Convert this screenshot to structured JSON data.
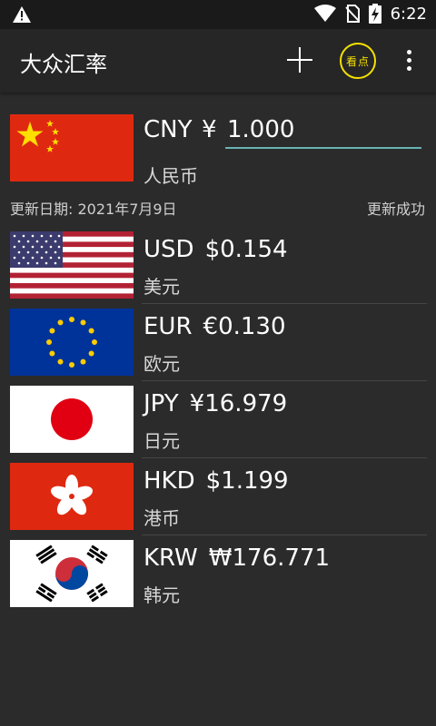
{
  "status_bar": {
    "time": "6:22"
  },
  "app_bar": {
    "title": "大众汇率",
    "kandian_label": "看点"
  },
  "base": {
    "code": "CNY",
    "symbol": "¥",
    "amount": "1.000",
    "name": "人民币"
  },
  "update_date": "更新日期: 2021年7月9日",
  "update_status": "更新成功",
  "currencies": [
    {
      "code": "USD",
      "value": "$0.154",
      "name": "美元"
    },
    {
      "code": "EUR",
      "value": "€0.130",
      "name": "欧元"
    },
    {
      "code": "JPY",
      "value": "¥16.979",
      "name": "日元"
    },
    {
      "code": "HKD",
      "value": "$1.199",
      "name": "港币"
    },
    {
      "code": "KRW",
      "value": "₩176.771",
      "name": "韩元"
    }
  ],
  "colors": {
    "accent_underline": "#6ab3b3",
    "kandian": "#f5e000",
    "background": "#2b2b2b"
  }
}
